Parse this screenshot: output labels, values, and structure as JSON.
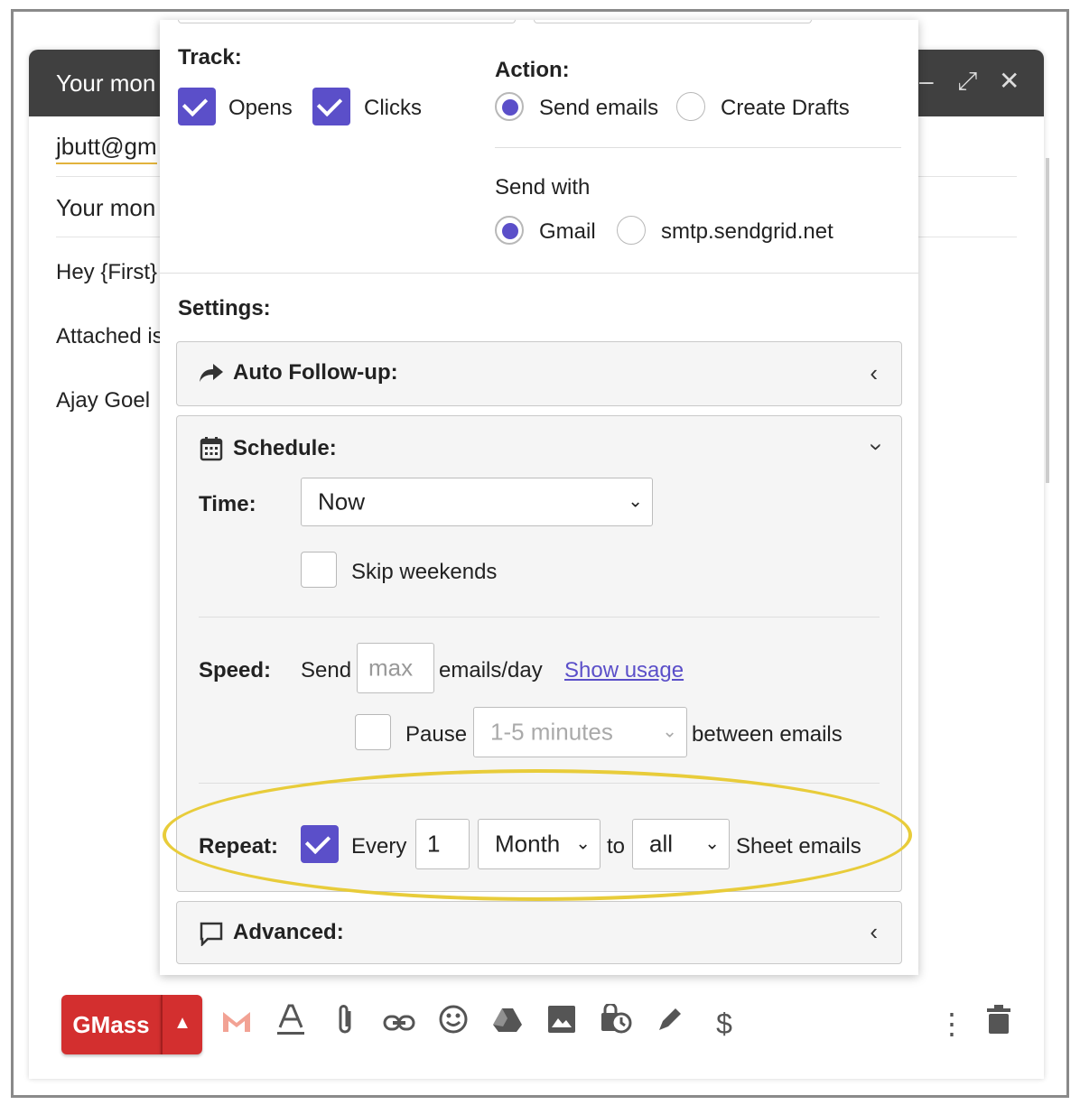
{
  "compose": {
    "title": "Your mon",
    "to": "jbutt@gm",
    "subject": "Your mon",
    "body_lines": [
      "Hey {First}",
      "Attached is",
      "Ajay Goel"
    ]
  },
  "popup": {
    "track": {
      "heading": "Track:",
      "opens_label": "Opens",
      "opens_checked": true,
      "clicks_label": "Clicks",
      "clicks_checked": true
    },
    "action": {
      "heading": "Action:",
      "send_label": "Send emails",
      "drafts_label": "Create Drafts",
      "selected": "Send emails"
    },
    "send_with": {
      "heading": "Send with",
      "gmail_label": "Gmail",
      "smtp_label": "smtp.sendgrid.net",
      "selected": "Gmail"
    },
    "settings_heading": "Settings:",
    "auto_followup": {
      "title": "Auto Follow-up:"
    },
    "schedule": {
      "title": "Schedule:",
      "time_label": "Time:",
      "time_value": "Now",
      "skip_weekends_label": "Skip weekends",
      "skip_weekends_checked": false,
      "speed_label": "Speed:",
      "send_label": "Send",
      "max_placeholder": "max",
      "per_day_label": "emails/day",
      "show_usage_link": "Show usage",
      "pause_label": "Pause",
      "pause_checked": false,
      "pause_value": "1-5 minutes",
      "between_label": "between emails",
      "repeat_label": "Repeat:",
      "repeat_checked": true,
      "every_label": "Every",
      "every_value": "1",
      "period_value": "Month",
      "to_label": "to",
      "target_value": "all",
      "sheet_label": "Sheet emails"
    },
    "advanced": {
      "title": "Advanced:"
    }
  },
  "toolbar": {
    "gmass_label": "GMass"
  },
  "colors": {
    "accent": "#5b4fc9",
    "gmass_red": "#d32f2f",
    "highlight": "#e8cc3a",
    "header_dark": "#404040"
  }
}
